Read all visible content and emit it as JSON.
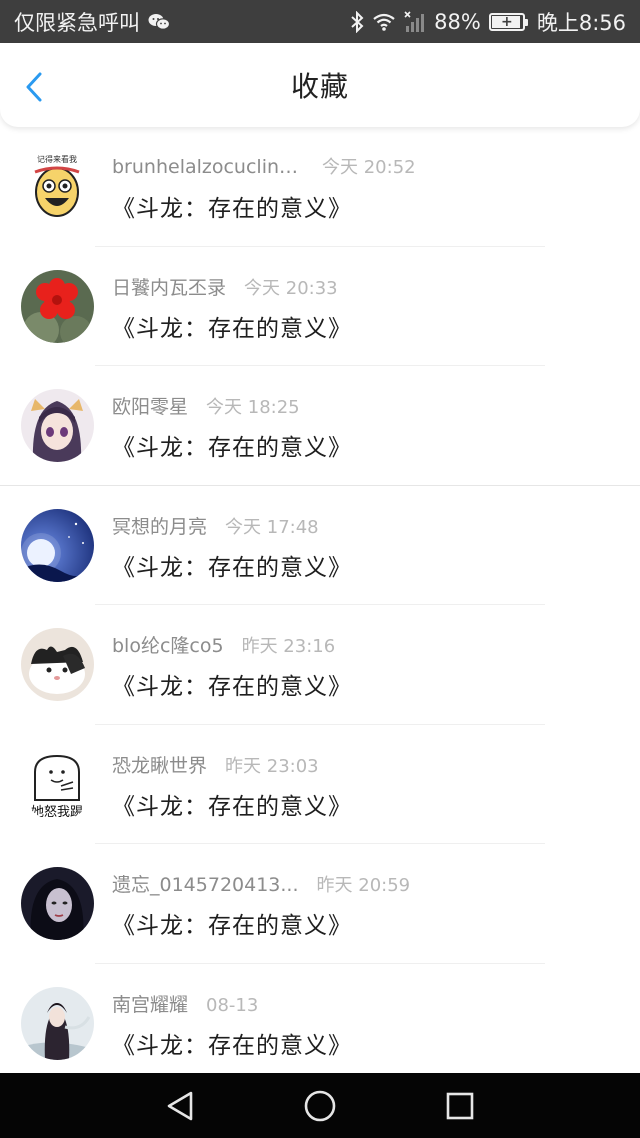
{
  "status_bar": {
    "carrier_text": "仅限紧急呼叫",
    "battery_percent": "88%",
    "time": "晚上8:56",
    "icons": [
      "wechat-icon",
      "bluetooth-icon",
      "wifi-icon",
      "no-signal-icon",
      "battery-charging-icon"
    ]
  },
  "header": {
    "title": "收藏",
    "back_icon": "chevron-left-icon",
    "accent_color": "#2a9af0"
  },
  "favorites": [
    {
      "user": "brunhelalzocucline...",
      "time": "今天 20:52",
      "title": "《斗龙：存在的意义》"
    },
    {
      "user": "日饕内瓦丕录",
      "time": "今天 20:33",
      "title": "《斗龙：存在的意义》"
    },
    {
      "user": "欧阳零星",
      "time": "今天 18:25",
      "title": "《斗龙：存在的意义》"
    },
    {
      "user": "冥想的月亮",
      "time": "今天 17:48",
      "title": "《斗龙：存在的意义》"
    },
    {
      "user": "blo纶c隆co5",
      "time": "昨天 23:16",
      "title": "《斗龙：存在的意义》"
    },
    {
      "user": "恐龙瞅世界",
      "time": "昨天 23:03",
      "title": "《斗龙：存在的意义》"
    },
    {
      "user": "遗忘_0145720413...",
      "time": "昨天 20:59",
      "title": "《斗龙：存在的意义》"
    },
    {
      "user": "南宫耀耀",
      "time": "08-13",
      "title": "《斗龙：存在的意义》"
    }
  ],
  "avatar_stickers": {
    "sticker_caption": "她怒我踢",
    "top_caption": "记得来看我"
  },
  "nav_bar": {
    "icons": [
      "back-triangle-icon",
      "home-circle-icon",
      "recents-square-icon"
    ]
  }
}
